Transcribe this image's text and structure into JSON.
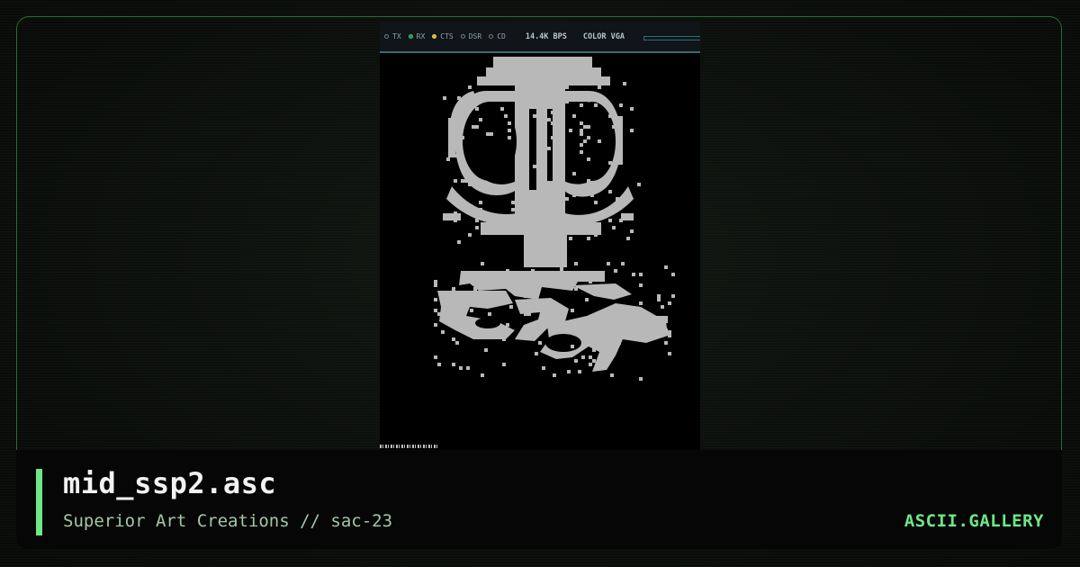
{
  "viewer": {
    "status_bar": {
      "leds": [
        {
          "label": "TX",
          "state": "off"
        },
        {
          "label": "RX",
          "state": "on-green"
        },
        {
          "label": "CTS",
          "state": "on-yellow"
        },
        {
          "label": "DSR",
          "state": "off"
        },
        {
          "label": "CD",
          "state": "off"
        }
      ],
      "speed": "14.4K BPS",
      "mode": "COLOR VGA",
      "progress": 0.0
    },
    "art_color": "#b8b8b8"
  },
  "footer": {
    "title": "mid_ssp2.asc",
    "subtitle": "Superior Art Creations // sac-23",
    "brand": "ASCII.GALLERY",
    "accent_color": "#6ee787"
  }
}
